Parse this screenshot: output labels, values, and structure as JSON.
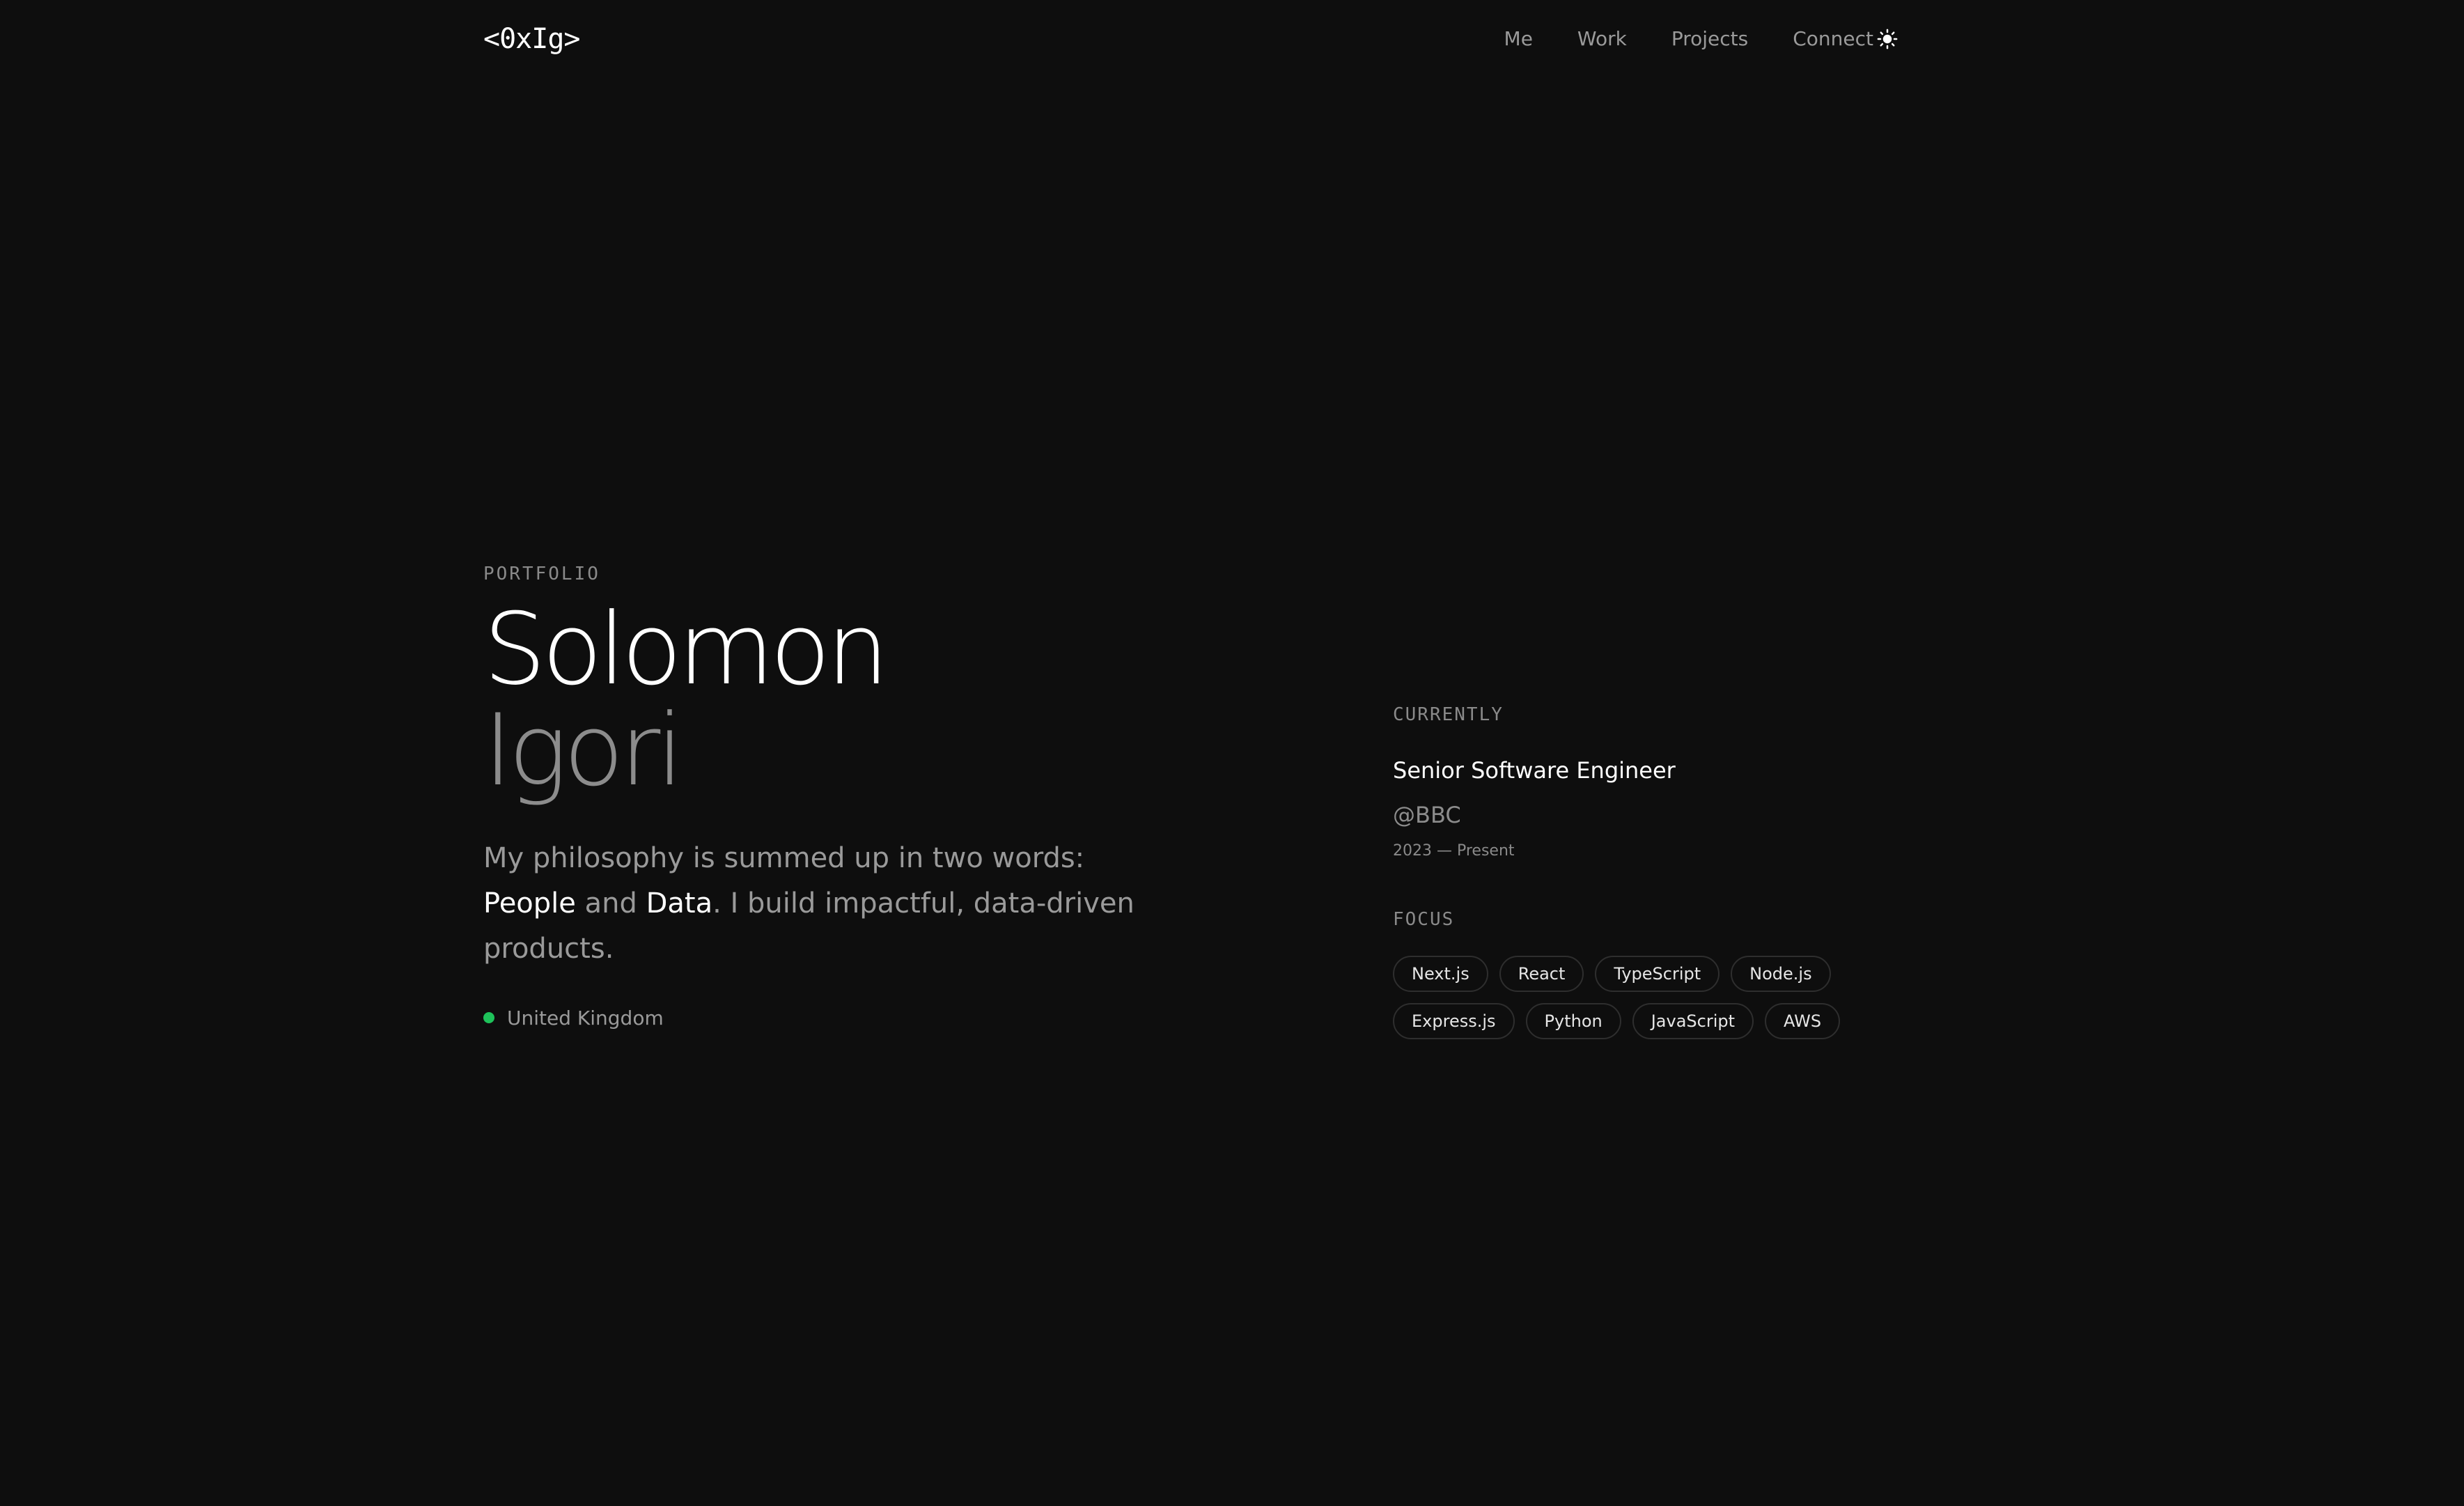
{
  "header": {
    "logo": "<0xIg>",
    "nav": [
      {
        "label": "Me"
      },
      {
        "label": "Work"
      },
      {
        "label": "Projects"
      },
      {
        "label": "Connect"
      }
    ],
    "theme_toggle_icon": "sun-icon"
  },
  "hero": {
    "eyebrow": "PORTFOLIO",
    "first_name": "Solomon",
    "last_name": "Igori",
    "philosophy": {
      "intro": "My philosophy is summed up in two words: ",
      "word1": "People",
      "conj": " and ",
      "word2": "Data",
      "rest": ". I build impactful, data-driven products."
    },
    "location": "United Kingdom",
    "location_status_color": "#1ec25a"
  },
  "current": {
    "label": "CURRENTLY",
    "role": "Senior Software Engineer",
    "company": "@BBC",
    "period": "2023 — Present"
  },
  "focus": {
    "label": "FOCUS",
    "tags": [
      "Next.js",
      "React",
      "TypeScript",
      "Node.js",
      "Express.js",
      "Python",
      "JavaScript",
      "AWS"
    ]
  },
  "colors": {
    "background": "#0e0e0e",
    "text_primary": "#ffffff",
    "text_muted": "#9a9a9a",
    "accent_green": "#1ec25a"
  }
}
